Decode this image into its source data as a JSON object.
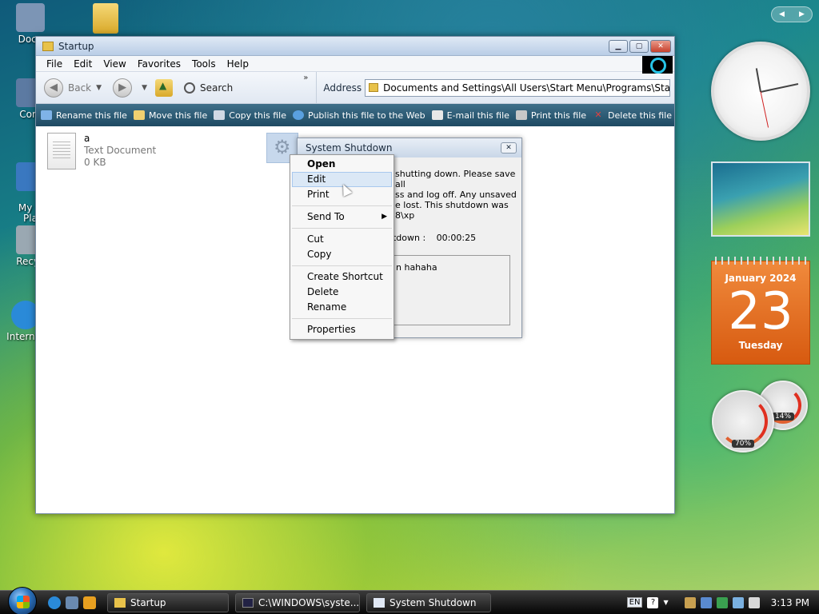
{
  "desktop": {
    "icons": [
      {
        "label": "Docu",
        "color": "#7c95b5"
      },
      {
        "label": "Com",
        "color": "#5c7aa2"
      },
      {
        "label": "My N\nPla",
        "color": "#3a78c0"
      },
      {
        "label": "Recyc",
        "color": "#9aa8b2"
      },
      {
        "label": "Internet",
        "color": "#2a8ad8"
      }
    ]
  },
  "explorer": {
    "title": "Startup",
    "menu": [
      "File",
      "Edit",
      "View",
      "Favorites",
      "Tools",
      "Help"
    ],
    "nav": {
      "back": "Back",
      "search": "Search",
      "address_label": "Address",
      "address": "Documents and Settings\\All Users\\Start Menu\\Programs\\Startup"
    },
    "tasks": [
      {
        "label": "Rename this file",
        "color": "#7fb3e8"
      },
      {
        "label": "Move this file",
        "color": "#f0d070"
      },
      {
        "label": "Copy this file",
        "color": "#d0d8e4"
      },
      {
        "label": "Publish this file to the Web",
        "color": "#5aa0e0"
      },
      {
        "label": "E-mail this file",
        "color": "#e8e8e8"
      },
      {
        "label": "Print this file",
        "color": "#c8c8c8"
      },
      {
        "label": "Delete this file",
        "color": "#e04040"
      }
    ],
    "file": {
      "name": "a",
      "type": "Text Document",
      "size": "0 KB"
    }
  },
  "dialog": {
    "title": "System Shutdown",
    "message": "shutting down. Please save all\nss and log off. Any unsaved\ne lost. This shutdown was\n8\\xp",
    "time_label": "utdown :",
    "time_value": "00:00:25",
    "comment": "n hahaha"
  },
  "context_menu": {
    "open": "Open",
    "edit": "Edit",
    "print": "Print",
    "send_to": "Send To",
    "cut": "Cut",
    "copy": "Copy",
    "create_shortcut": "Create Shortcut",
    "delete": "Delete",
    "rename": "Rename",
    "properties": "Properties"
  },
  "gadgets": {
    "calendar": {
      "month": "January 2024",
      "day": "23",
      "weekday": "Tuesday"
    },
    "cpu_meter": {
      "cpu": "70%",
      "memory": "14%"
    }
  },
  "taskbar": {
    "windows": [
      {
        "label": "Startup",
        "color": "#e8c24a"
      },
      {
        "label": "C:\\WINDOWS\\syste...",
        "color": "#222244"
      },
      {
        "label": "System Shutdown",
        "color": "#e0e8f4"
      }
    ],
    "tray": {
      "lang": "EN",
      "time": "3:13 PM"
    }
  }
}
